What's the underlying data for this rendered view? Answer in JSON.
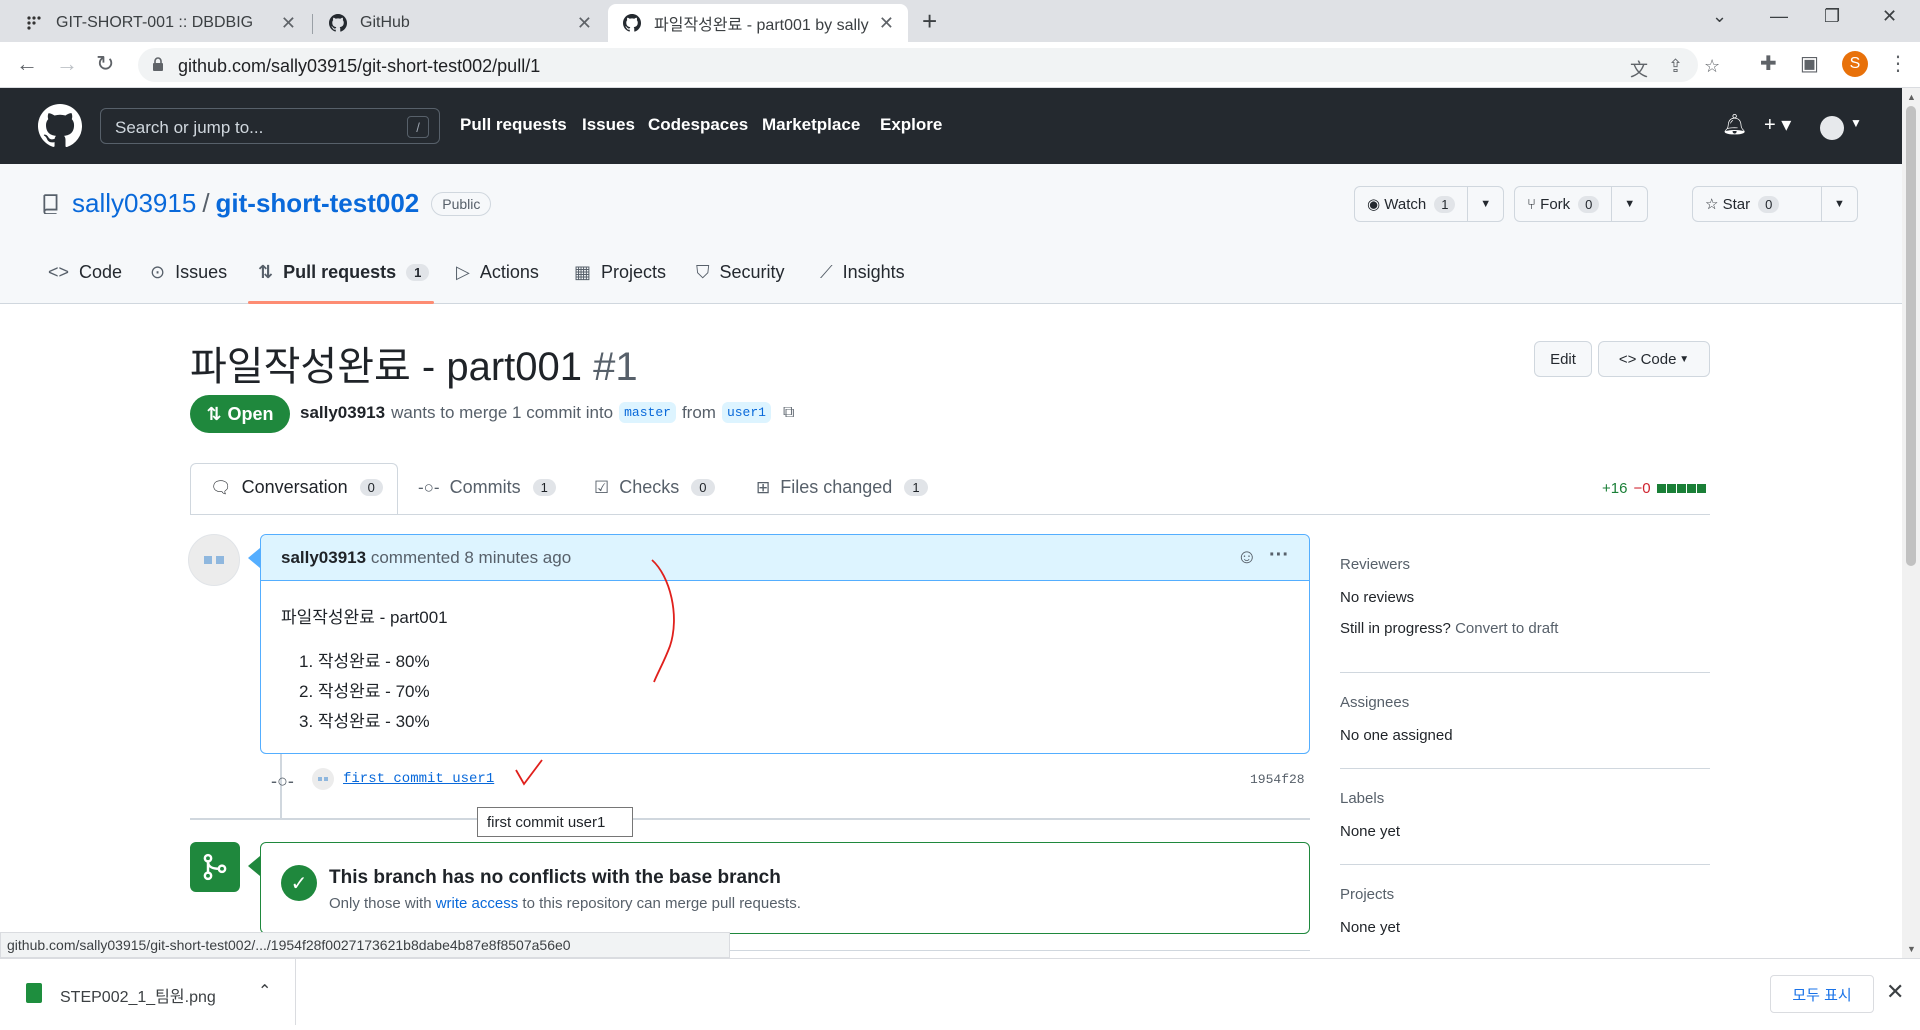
{
  "browser": {
    "tabs": [
      {
        "title": "GIT-SHORT-001 :: DBDBIG",
        "icon": "dbdbig-icon"
      },
      {
        "title": "GitHub",
        "icon": "github-icon"
      },
      {
        "title": "파일작성완료 - part001 by sally",
        "icon": "github-icon",
        "active": true
      }
    ],
    "url": "github.com/sally03915/git-short-test002/pull/1",
    "profile_initial": "S"
  },
  "github_header": {
    "search_placeholder": "Search or jump to...",
    "search_shortcut": "/",
    "nav": [
      "Pull requests",
      "Issues",
      "Codespaces",
      "Marketplace",
      "Explore"
    ]
  },
  "repo": {
    "owner": "sally03915",
    "separator": "/",
    "name": "git-short-test002",
    "visibility": "Public",
    "watch": {
      "label": "Watch",
      "count": "1"
    },
    "fork": {
      "label": "Fork",
      "count": "0"
    },
    "star": {
      "label": "Star",
      "count": "0"
    },
    "tabs": [
      {
        "label": "Code",
        "icon": "code-icon"
      },
      {
        "label": "Issues",
        "icon": "issue-icon"
      },
      {
        "label": "Pull requests",
        "icon": "pull-request-icon",
        "count": "1",
        "selected": true
      },
      {
        "label": "Actions",
        "icon": "play-icon"
      },
      {
        "label": "Projects",
        "icon": "table-icon"
      },
      {
        "label": "Security",
        "icon": "shield-icon"
      },
      {
        "label": "Insights",
        "icon": "graph-icon"
      }
    ]
  },
  "pr": {
    "title": "파일작성완료 - part001",
    "number": "#1",
    "edit_label": "Edit",
    "code_label": "Code",
    "state": "Open",
    "author": "sally03913",
    "merge_text": "wants to merge 1 commit into",
    "base_branch": "master",
    "from_text": "from",
    "head_branch": "user1",
    "tabs": [
      {
        "label": "Conversation",
        "count": "0",
        "selected": true
      },
      {
        "label": "Commits",
        "count": "1"
      },
      {
        "label": "Checks",
        "count": "0"
      },
      {
        "label": "Files changed",
        "count": "1"
      }
    ],
    "additions": "+16",
    "deletions": "−0"
  },
  "comment": {
    "author": "sally03913",
    "meta": "commented 8 minutes ago",
    "body_title": "파일작성완료 - part001",
    "items": [
      "1. 작성완료 - 80%",
      "2. 작성완료 - 70%",
      "3. 작성완료 - 30%"
    ]
  },
  "commit": {
    "message": "first commit user1",
    "sha": "1954f28",
    "tooltip": "first  commit  user1"
  },
  "merge": {
    "title": "This branch has no conflicts with the base branch",
    "sub_before": "Only those with",
    "sub_link": "write access",
    "sub_after": "to this repository can merge pull requests."
  },
  "sidebar": {
    "reviewers_label": "Reviewers",
    "reviewers_value": "No reviews",
    "progress_text": "Still in progress?",
    "progress_link": "Convert to draft",
    "assignees_label": "Assignees",
    "assignees_value": "No one assigned",
    "labels_label": "Labels",
    "labels_value": "None yet",
    "projects_label": "Projects",
    "projects_value": "None yet"
  },
  "statusbar_url": "github.com/sally03915/git-short-test002/.../1954f28f0027173621b8dabe4b87e8f8507a56e0",
  "download": {
    "filename": "STEP002_1_팀원.png",
    "show_all": "모두 표시"
  },
  "colors": {
    "accent": "#0969da",
    "open_green": "#1f883d",
    "header_dark": "#24292f",
    "underline": "#fd8c73"
  }
}
